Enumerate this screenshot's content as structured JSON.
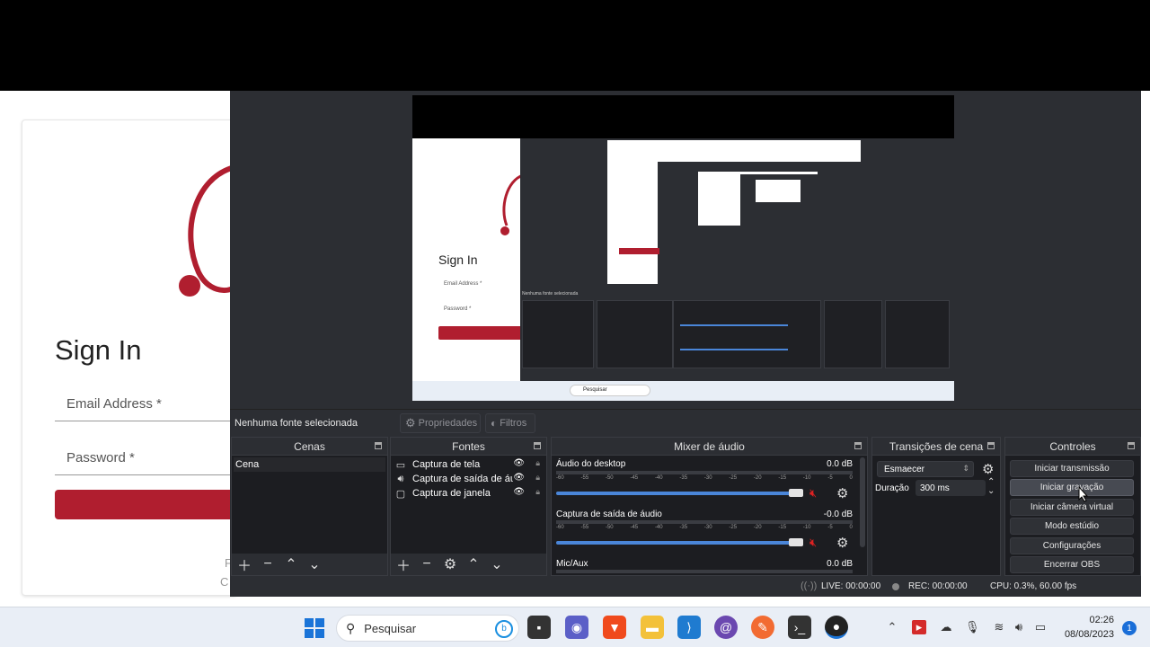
{
  "background_page": {
    "title": "Sign In",
    "email_label": "Email Address *",
    "password_label": "Password *",
    "brand_color": "#b01e2f",
    "footer_left_1": "F",
    "footer_left_2": "C"
  },
  "obs": {
    "preview": {
      "nested_signin_title": "Sign In",
      "nested_email_label": "Email Address *",
      "nested_password_label": "Password *",
      "nested_no_source": "Nenhuma fonte selecionada",
      "nested_search": "Pesquisar"
    },
    "toolbar": {
      "no_source": "Nenhuma fonte selecionada",
      "properties": "Propriedades",
      "filters": "Filtros"
    },
    "scenes": {
      "header": "Cenas",
      "items": [
        "Cena"
      ]
    },
    "sources": {
      "header": "Fontes",
      "items": [
        {
          "label": "Captura de tela",
          "icon": "monitor-icon"
        },
        {
          "label": "Captura de saída de áu",
          "icon": "speaker-icon"
        },
        {
          "label": "Captura de janela",
          "icon": "window-icon"
        }
      ]
    },
    "mixer": {
      "header": "Mixer de áudio",
      "ticks": [
        "-60",
        "-55",
        "-50",
        "-45",
        "-40",
        "-35",
        "-30",
        "-25",
        "-20",
        "-15",
        "-10",
        "-5",
        "0"
      ],
      "channels": [
        {
          "name": "Áudio do desktop",
          "db": "0.0 dB",
          "level": 0.82
        },
        {
          "name": "Captura de saída de áudio",
          "db": "-0.0 dB",
          "level": 0.82
        },
        {
          "name": "Mic/Aux",
          "db": "0.0 dB",
          "level": 0.82
        }
      ]
    },
    "transitions": {
      "header": "Transições de cena",
      "selected": "Esmaecer",
      "duration_label": "Duração",
      "duration_value": "300 ms"
    },
    "controls": {
      "header": "Controles",
      "buttons": [
        "Iniciar transmissão",
        "Iniciar gravação",
        "Iniciar câmera virtual",
        "Modo estúdio",
        "Configurações",
        "Encerrar OBS"
      ]
    },
    "status": {
      "live": "LIVE: 00:00:00",
      "rec": "REC: 00:00:00",
      "cpu": "CPU: 0.3%, 60.00 fps"
    }
  },
  "taskbar": {
    "search_placeholder": "Pesquisar",
    "time": "02:26",
    "date": "08/08/2023",
    "notifications": "1"
  }
}
